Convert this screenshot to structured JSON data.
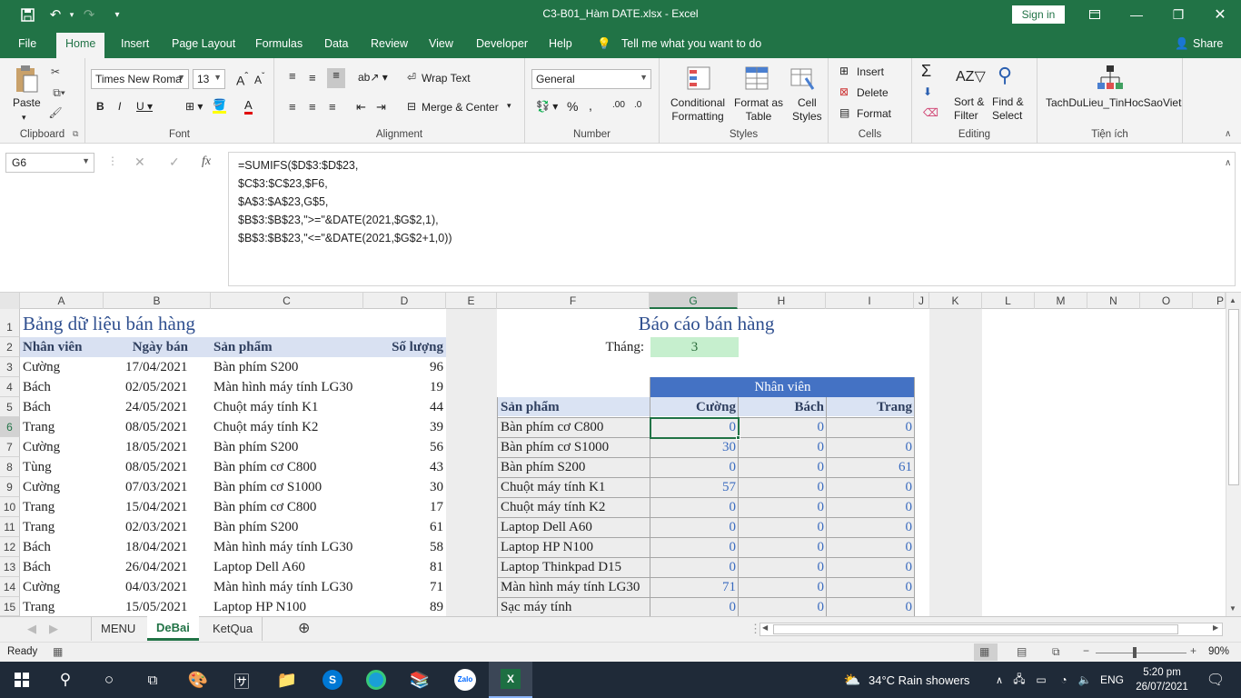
{
  "window": {
    "title": "C3-B01_Hàm DATE.xlsx  -  Excel",
    "sign_in": "Sign in"
  },
  "ribbon_tabs": [
    "File",
    "Home",
    "Insert",
    "Page Layout",
    "Formulas",
    "Data",
    "Review",
    "View",
    "Developer",
    "Help"
  ],
  "tell_me": "Tell me what you want to do",
  "share": "Share",
  "clipboard": {
    "paste": "Paste",
    "label": "Clipboard"
  },
  "font": {
    "name": "Times New Roma",
    "size": "13",
    "label": "Font"
  },
  "alignment": {
    "wrap": "Wrap Text",
    "merge": "Merge & Center",
    "label": "Alignment"
  },
  "number": {
    "format": "General",
    "label": "Number"
  },
  "styles": {
    "cond1": "Conditional",
    "cond2": "Formatting",
    "fmt1": "Format as",
    "fmt2": "Table",
    "cell1": "Cell",
    "cell2": "Styles",
    "label": "Styles"
  },
  "cells": {
    "insert": "Insert",
    "delete": "Delete",
    "format": "Format",
    "label": "Cells"
  },
  "editing": {
    "sort1": "Sort &",
    "sort2": "Filter",
    "find1": "Find &",
    "find2": "Select",
    "label": "Editing"
  },
  "addin": {
    "name": "TachDuLieu_TinHocSaoViet",
    "label": "Tiện ích"
  },
  "formula_bar": {
    "name_box": "G6",
    "fx": "fx",
    "lines": [
      "=SUMIFS($D$3:$D$23,",
      "$C$3:$C$23,$F6,",
      "$A$3:$A$23,G$5,",
      "$B$3:$B$23,\">=\"&DATE(2021,$G$2,1),",
      "$B$3:$B$23,\"<=\"&DATE(2021,$G$2+1,0))"
    ]
  },
  "columns": [
    "A",
    "B",
    "C",
    "D",
    "E",
    "F",
    "G",
    "H",
    "I",
    "J",
    "K",
    "L",
    "M",
    "N",
    "O",
    "P"
  ],
  "rows": [
    "1",
    "2",
    "3",
    "4",
    "5",
    "6",
    "7",
    "8",
    "9",
    "10",
    "11",
    "12",
    "13",
    "14",
    "15"
  ],
  "data_table": {
    "title": "Bảng dữ liệu bán hàng",
    "headers": [
      "Nhân viên",
      "Ngày bán",
      "Sản phẩm",
      "Số lượng"
    ],
    "rows": [
      [
        "Cường",
        "17/04/2021",
        "Bàn phím S200",
        "96"
      ],
      [
        "Bách",
        "02/05/2021",
        "Màn hình máy tính LG30",
        "19"
      ],
      [
        "Bách",
        "24/05/2021",
        "Chuột máy tính K1",
        "44"
      ],
      [
        "Trang",
        "08/05/2021",
        "Chuột máy tính K2",
        "39"
      ],
      [
        "Cường",
        "18/05/2021",
        "Bàn phím S200",
        "56"
      ],
      [
        "Tùng",
        "08/05/2021",
        "Bàn phím cơ C800",
        "43"
      ],
      [
        "Cường",
        "07/03/2021",
        "Bàn phím cơ S1000",
        "30"
      ],
      [
        "Trang",
        "15/04/2021",
        "Bàn phím cơ C800",
        "17"
      ],
      [
        "Trang",
        "02/03/2021",
        "Bàn phím S200",
        "61"
      ],
      [
        "Bách",
        "18/04/2021",
        "Màn hình máy tính LG30",
        "58"
      ],
      [
        "Bách",
        "26/04/2021",
        "Laptop Dell A60",
        "81"
      ],
      [
        "Cường",
        "04/03/2021",
        "Màn hình máy tính LG30",
        "71"
      ],
      [
        "Trang",
        "15/05/2021",
        "Laptop HP N100",
        "89"
      ]
    ]
  },
  "report": {
    "title": "Báo cáo bán hàng",
    "month_label": "Tháng:",
    "month_value": "3",
    "staff_header": "Nhân viên",
    "product_header": "Sản phẩm",
    "staff": [
      "Cường",
      "Bách",
      "Trang"
    ],
    "rows": [
      [
        "Bàn phím cơ C800",
        "0",
        "0",
        "0"
      ],
      [
        "Bàn phím cơ S1000",
        "30",
        "0",
        "0"
      ],
      [
        "Bàn phím S200",
        "0",
        "0",
        "61"
      ],
      [
        "Chuột máy tính K1",
        "57",
        "0",
        "0"
      ],
      [
        "Chuột máy tính K2",
        "0",
        "0",
        "0"
      ],
      [
        "Laptop Dell A60",
        "0",
        "0",
        "0"
      ],
      [
        "Laptop HP N100",
        "0",
        "0",
        "0"
      ],
      [
        "Laptop Thinkpad D15",
        "0",
        "0",
        "0"
      ],
      [
        "Màn hình máy tính LG30",
        "71",
        "0",
        "0"
      ],
      [
        "Sạc máy tính",
        "0",
        "0",
        "0"
      ]
    ]
  },
  "sheets": [
    "MENU",
    "DeBai",
    "KetQua"
  ],
  "active_sheet": "DeBai",
  "status": {
    "ready": "Ready",
    "zoom": "90%"
  },
  "taskbar": {
    "weather": "34°C  Rain showers",
    "lang": "ENG",
    "time": "5:20 pm",
    "date": "26/07/2021"
  },
  "colors": {
    "excel_green": "#217346",
    "header_blue": "#4472c4",
    "light_blue": "#dae3f3",
    "month_green": "#c6efce"
  }
}
